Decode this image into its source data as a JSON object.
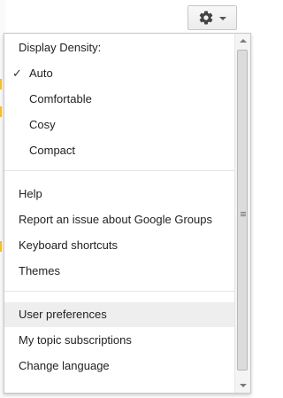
{
  "settings": {
    "gear_icon": "gear-icon",
    "caret_icon": "chevron-down-icon"
  },
  "menu": {
    "density_heading": "Display Density:",
    "density_options": [
      {
        "label": "Auto",
        "checked": true
      },
      {
        "label": "Comfortable",
        "checked": false
      },
      {
        "label": "Cosy",
        "checked": false
      },
      {
        "label": "Compact",
        "checked": false
      }
    ],
    "check_glyph": "✓",
    "help_items": [
      {
        "label": "Help"
      },
      {
        "label": "Report an issue about Google Groups"
      },
      {
        "label": "Keyboard shortcuts"
      },
      {
        "label": "Themes"
      }
    ],
    "pref_items": [
      {
        "label": "User preferences",
        "highlighted": true
      },
      {
        "label": "My topic subscriptions",
        "highlighted": false
      },
      {
        "label": "Change language",
        "highlighted": false
      }
    ]
  }
}
